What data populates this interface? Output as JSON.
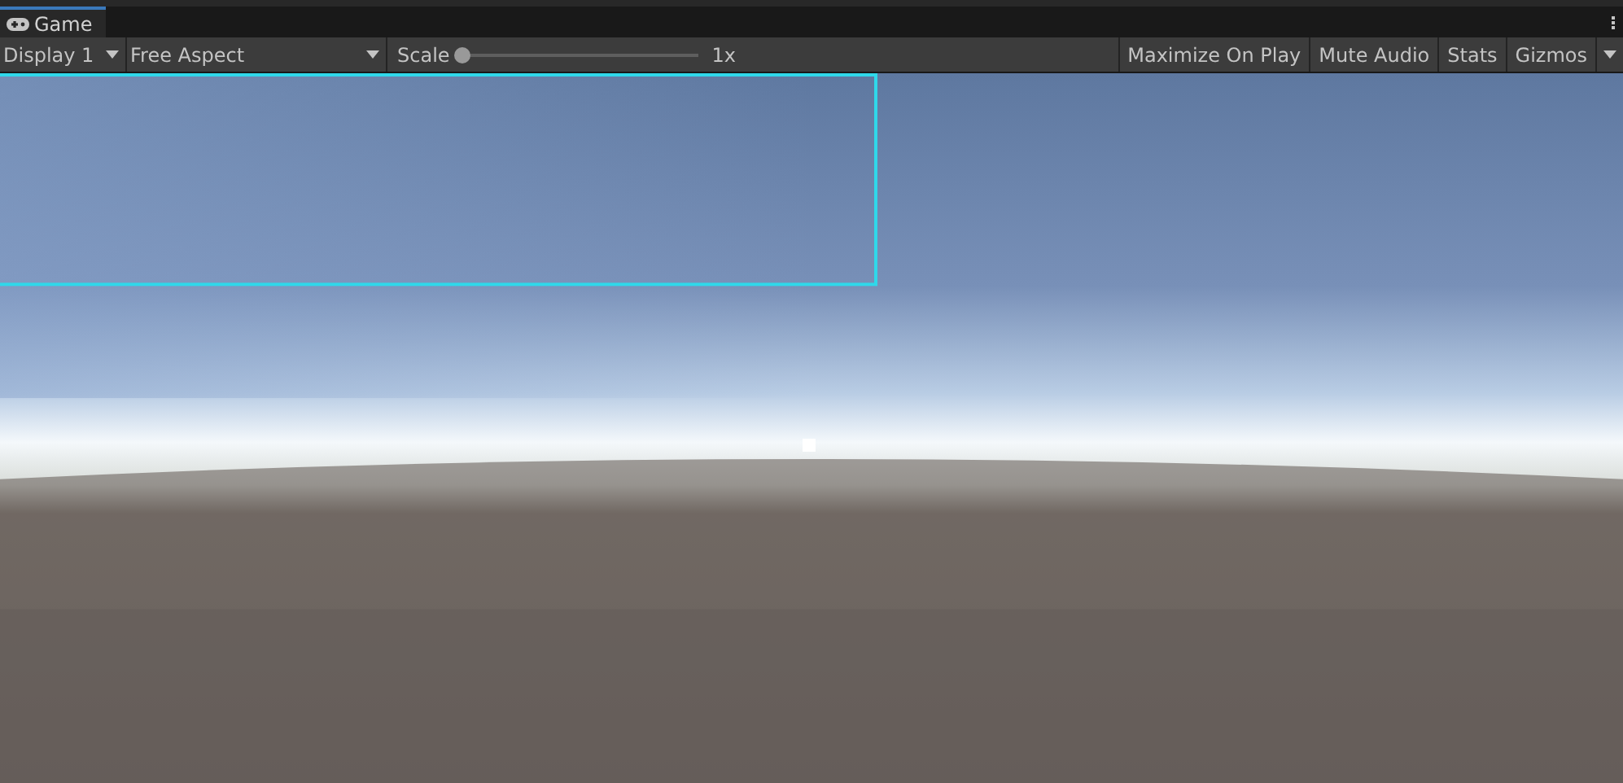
{
  "tabs": [
    {
      "label": "Game",
      "selected": true
    }
  ],
  "toolbar": {
    "display": {
      "value": "Display 1"
    },
    "aspect": {
      "value": "Free Aspect"
    },
    "scale": {
      "label": "Scale",
      "level": 0,
      "reading": "1x"
    },
    "toggles": [
      {
        "label": "Maximize On Play",
        "on": false
      },
      {
        "label": "Mute Audio",
        "on": false
      },
      {
        "label": "Stats",
        "on": false
      },
      {
        "label": "Gizmos",
        "on": false
      }
    ]
  }
}
